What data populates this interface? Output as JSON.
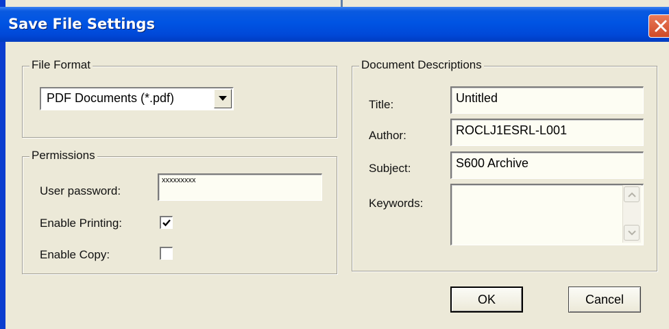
{
  "window": {
    "title": "Save File Settings",
    "close_icon": "close-icon"
  },
  "file_format": {
    "legend": "File Format",
    "selected": "PDF Documents (*.pdf)",
    "dropdown_icon": "chevron-down-icon"
  },
  "permissions": {
    "legend": "Permissions",
    "user_password_label": "User password:",
    "user_password_value": "xxxxxxxxx",
    "enable_printing_label": "Enable Printing:",
    "enable_printing_checked": true,
    "enable_copy_label": "Enable Copy:",
    "enable_copy_checked": false
  },
  "document_descriptions": {
    "legend": "Document Descriptions",
    "title_label": "Title:",
    "title_value": "Untitled",
    "author_label": "Author:",
    "author_value": "ROCLJ1ESRL-L001",
    "subject_label": "Subject:",
    "subject_value": "S600 Archive",
    "keywords_label": "Keywords:",
    "keywords_value": ""
  },
  "buttons": {
    "ok": "OK",
    "cancel": "Cancel"
  },
  "colors": {
    "title_bar": "#0054e3",
    "dialog_bg": "#ece9d8",
    "close_button": "#d04a26"
  }
}
